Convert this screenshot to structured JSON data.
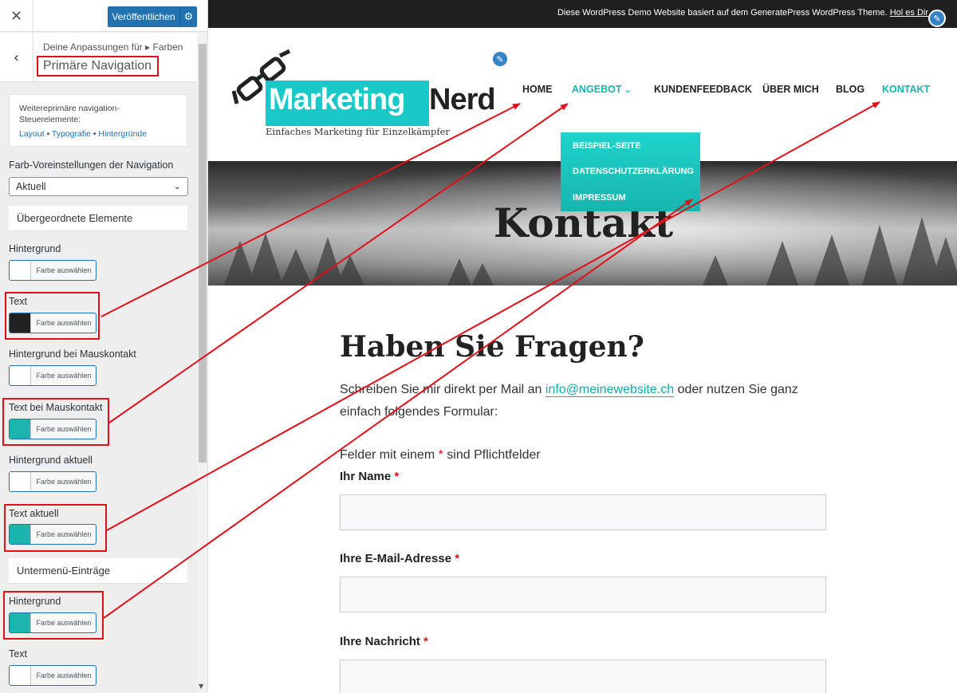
{
  "customizer": {
    "close_icon": "close-icon",
    "publish_label": "Veröffentlichen",
    "breadcrumb": "Deine Anpassungen für ▸ Farben",
    "section_title": "Primäre Navigation",
    "info": {
      "heading": "Weitereprimäre navigation-Steuerelemente:",
      "links": [
        "Layout",
        "Typografie",
        "Hintergründe"
      ],
      "separator": " • "
    },
    "preset_label": "Farb-Voreinstellungen der Navigation",
    "preset_value": "Aktuell",
    "groups": {
      "parent": "Übergeordnete Elemente",
      "submenu": "Untermenü-Einträge"
    },
    "picker_label": "Farbe auswählen",
    "colors": [
      {
        "label": "Hintergrund",
        "swatch": "#ffffff"
      },
      {
        "label": "Text",
        "swatch": "#222222"
      },
      {
        "label": "Hintergrund bei Mauskontakt",
        "swatch": "#ffffff"
      },
      {
        "label": "Text bei Mauskontakt",
        "swatch": "#1bb5ad"
      },
      {
        "label": "Hintergrund aktuell",
        "swatch": "#ffffff"
      },
      {
        "label": "Text aktuell",
        "swatch": "#1bb5ad"
      },
      {
        "label": "Hintergrund",
        "swatch": "#1bb5ad"
      },
      {
        "label": "Text",
        "swatch": "#ffffff"
      }
    ],
    "highlight_color": "#e0101a",
    "accent_color": "#2271b1"
  },
  "site": {
    "topbar_text": "Diese WordPress Demo Website basiert auf dem GeneratePress WordPress Theme.",
    "topbar_link": "Hol es Dir",
    "logo": {
      "part1": "Marketing",
      "part2": "Nerd",
      "tagline": "Einfaches Marketing für Einzelkämpfer"
    },
    "nav": [
      "HOME",
      "ANGEBOT",
      "KUNDENFEEDBACK",
      "ÜBER MICH",
      "BLOG",
      "KONTAKT"
    ],
    "dropdown": [
      "BEISPIEL-SEITE",
      "DATENSCHUTZERKLÄRUNG",
      "IMPRESSUM"
    ],
    "hero_title": "Kontakt",
    "heading": "Haben Sie Fragen?",
    "intro_before": "Schreiben Sie mir direkt per Mail an",
    "intro_email": "info@meinewebsite.ch",
    "intro_after": "oder nutzen Sie ganz",
    "intro_line2": "einfach folgendes Formular:",
    "required_before": "Felder mit einem",
    "required_after": "sind Pflichtfelder",
    "required_star": "*",
    "fields": [
      "Ihr Name",
      "Ihre E-Mail-Adresse",
      "Ihre Nachricht"
    ],
    "accent_color": "#1bc8c8"
  }
}
